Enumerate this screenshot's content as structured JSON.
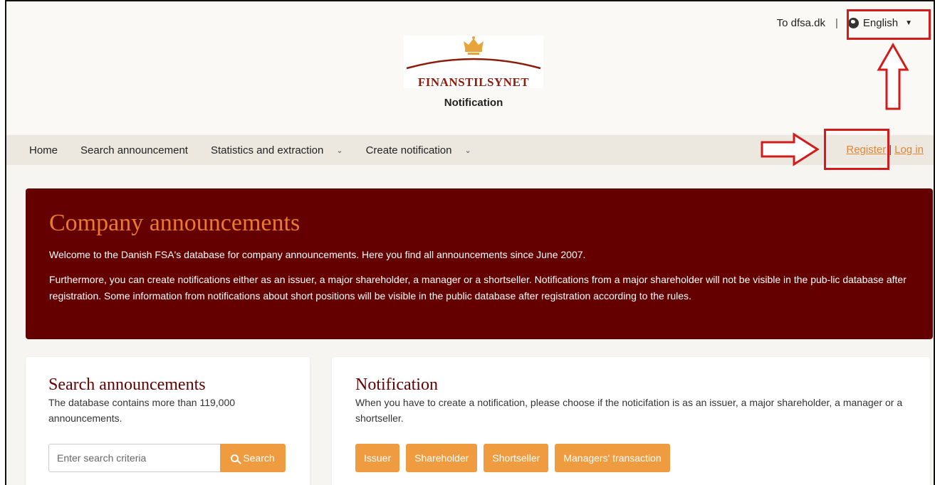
{
  "top": {
    "dfsa_link": "To dfsa.dk",
    "separator": "|",
    "language": "English"
  },
  "logo": {
    "name": "FINANSTILSYNET",
    "subtitle": "Notification"
  },
  "nav": {
    "items": [
      {
        "label": "Home"
      },
      {
        "label": "Search announcement"
      },
      {
        "label": "Statistics and extraction"
      },
      {
        "label": "Create notification"
      }
    ],
    "register": "Register",
    "login": "Log in"
  },
  "hero": {
    "title": "Company announcements",
    "p1": "Welcome to the Danish FSA's database for company announcements. Here you find all announcements since June 2007.",
    "p2": "Furthermore, you can create notifications either as an issuer, a major shareholder, a manager or a shortseller. Notifications from a major shareholder will not be visible in the pub-lic database after registration. Some information from notifications about short positions will be visible in the public database after registration according to the rules."
  },
  "search_card": {
    "title": "Search announcements",
    "text": "The database contains more than 119,000 announcements.",
    "placeholder": "Enter search criteria",
    "button": "Search"
  },
  "notif_card": {
    "title": "Notification",
    "text": "When you have to create a notification, please choose if the noticifation is as an issuer, a major shareholder, a manager or a shortseller.",
    "buttons": [
      "Issuer",
      "Shareholder",
      "Shortseller",
      "Managers' transaction"
    ]
  },
  "colors": {
    "brand_dark": "#650000",
    "accent_orange": "#ef9b3f",
    "highlight_red": "#d21c1c"
  }
}
